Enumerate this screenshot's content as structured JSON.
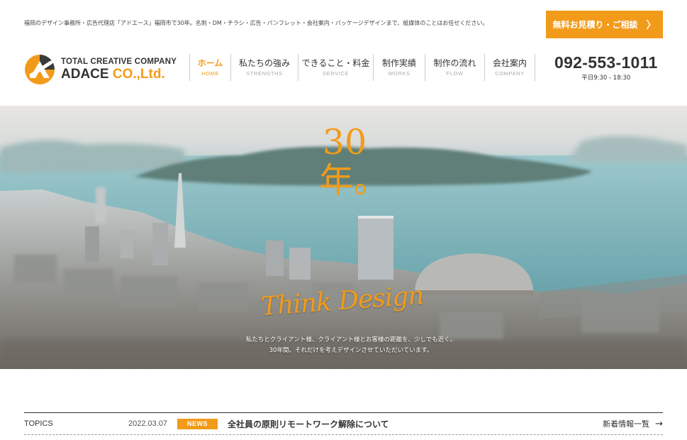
{
  "header": {
    "tagline": "福岡のデザイン事務所・広告代理店「アドエース」福岡市で30年。名刺・DM・チラシ・広告・パンフレット・会社案内・パッケージデザインまで、紙媒体のことはお任せください。",
    "cta_label": "無料お見積り・ご相談",
    "cta_arrow": "〉",
    "logo_sub": "TOTAL CREATIVE COMPANY",
    "logo_main_a": "ADACE",
    "logo_main_b": "CO.,Ltd.",
    "phone": "092-553-1011",
    "hours": "平日9:30 - 18:30"
  },
  "nav": [
    {
      "jp": "ホーム",
      "en": "HOME",
      "active": true
    },
    {
      "jp": "私たちの強み",
      "en": "STRENGTHS",
      "active": false
    },
    {
      "jp": "できること・料金",
      "en": "SERVICE",
      "active": false
    },
    {
      "jp": "制作実績",
      "en": "WORKS",
      "active": false
    },
    {
      "jp": "制作の流れ",
      "en": "FLOW",
      "active": false
    },
    {
      "jp": "会社案内",
      "en": "COMPANY",
      "active": false
    }
  ],
  "hero": {
    "heading_line1": "30",
    "heading_line2": "年。",
    "script": "Think Design",
    "copy_line1": "私たちとクライアント様、クライアント様とお客様の距離を、少しでも近く。",
    "copy_line2": "30年間、それだけを考えデザインさせていただいています。"
  },
  "topics": {
    "label": "TOPICS",
    "date": "2022.03.07",
    "badge": "NEWS",
    "title": "全社員の原則リモートワーク解除について",
    "more": "新着情報一覧",
    "more_arrow": "→"
  },
  "colors": {
    "accent": "#f29b1a",
    "text": "#333333"
  },
  "icons": {
    "cta": "chevron-right-icon",
    "more": "arrow-right-icon",
    "logo": "adace-logo-mark"
  }
}
